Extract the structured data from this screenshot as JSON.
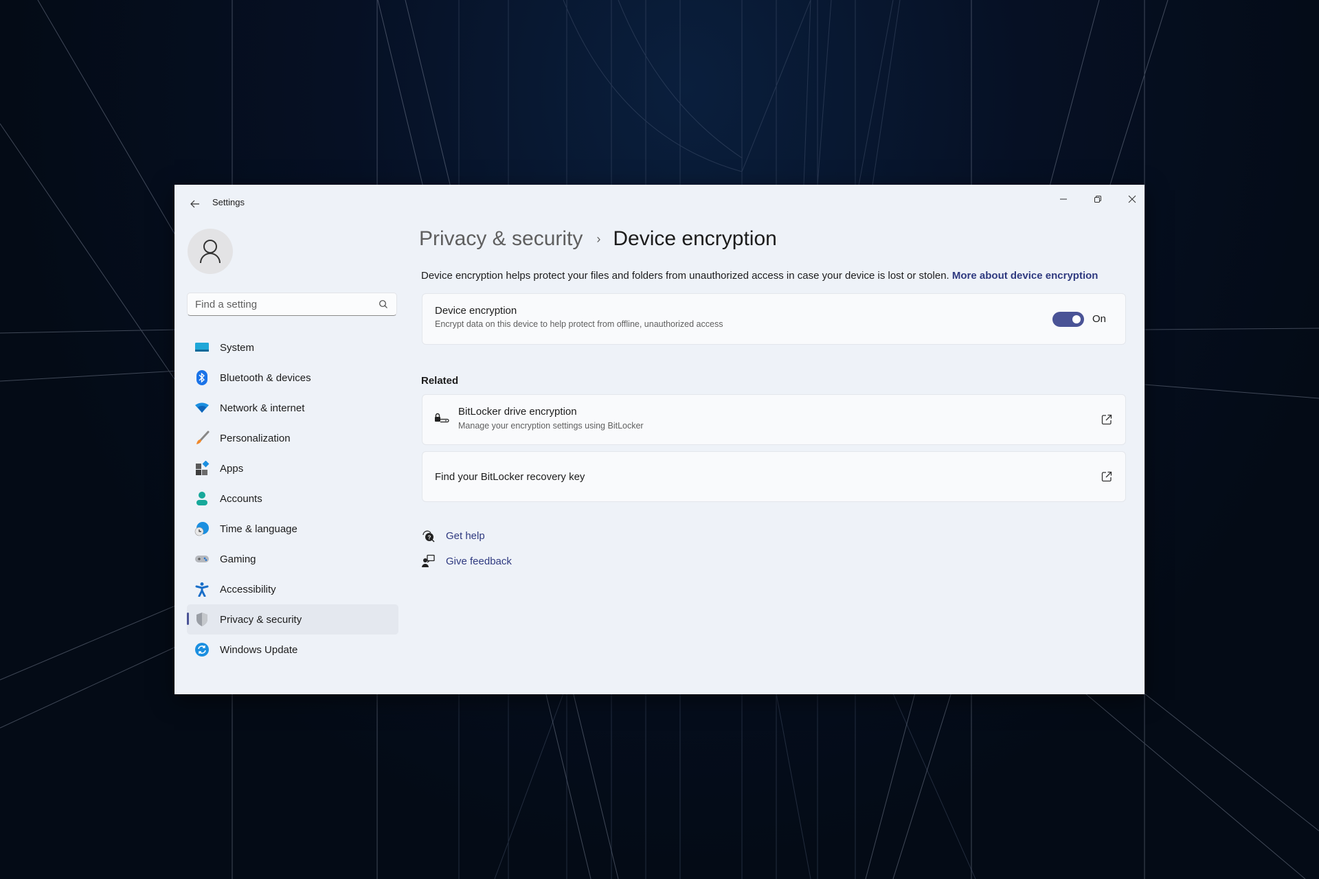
{
  "window": {
    "title": "Settings",
    "controls": {
      "minimize": "minimize-icon",
      "restore": "restore-icon",
      "close": "close-icon"
    }
  },
  "sidebar": {
    "search_placeholder": "Find a setting",
    "search_value": "",
    "items": [
      {
        "label": "System",
        "icon": "system-icon",
        "selected": false
      },
      {
        "label": "Bluetooth & devices",
        "icon": "bluetooth-icon",
        "selected": false
      },
      {
        "label": "Network & internet",
        "icon": "wifi-icon",
        "selected": false
      },
      {
        "label": "Personalization",
        "icon": "paintbrush-icon",
        "selected": false
      },
      {
        "label": "Apps",
        "icon": "apps-icon",
        "selected": false
      },
      {
        "label": "Accounts",
        "icon": "accounts-icon",
        "selected": false
      },
      {
        "label": "Time & language",
        "icon": "time-language-icon",
        "selected": false
      },
      {
        "label": "Gaming",
        "icon": "gamepad-icon",
        "selected": false
      },
      {
        "label": "Accessibility",
        "icon": "accessibility-icon",
        "selected": false
      },
      {
        "label": "Privacy & security",
        "icon": "shield-icon",
        "selected": true
      },
      {
        "label": "Windows Update",
        "icon": "windows-update-icon",
        "selected": false
      }
    ]
  },
  "main": {
    "breadcrumb": {
      "parent": "Privacy & security",
      "separator": "›",
      "current": "Device encryption"
    },
    "description": "Device encryption helps protect your files and folders from unauthorized access in case your device is lost or stolen.",
    "description_link": "More about device encryption",
    "encryption_card": {
      "title": "Device encryption",
      "subtitle": "Encrypt data on this device to help protect from offline, unauthorized access",
      "toggle_state": "on",
      "toggle_label": "On"
    },
    "related_heading": "Related",
    "related": [
      {
        "title": "BitLocker drive encryption",
        "subtitle": "Manage your encryption settings using BitLocker",
        "icon": "bitlocker-drive-icon"
      },
      {
        "title": "Find your BitLocker recovery key"
      }
    ],
    "help_links": [
      {
        "label": "Get help",
        "icon": "get-help-icon"
      },
      {
        "label": "Give feedback",
        "icon": "give-feedback-icon"
      }
    ]
  },
  "colors": {
    "accent": "#4a5396",
    "link": "#2f3a80",
    "window_bg": "#eef2f8",
    "card_bg": "#f9fafc"
  }
}
